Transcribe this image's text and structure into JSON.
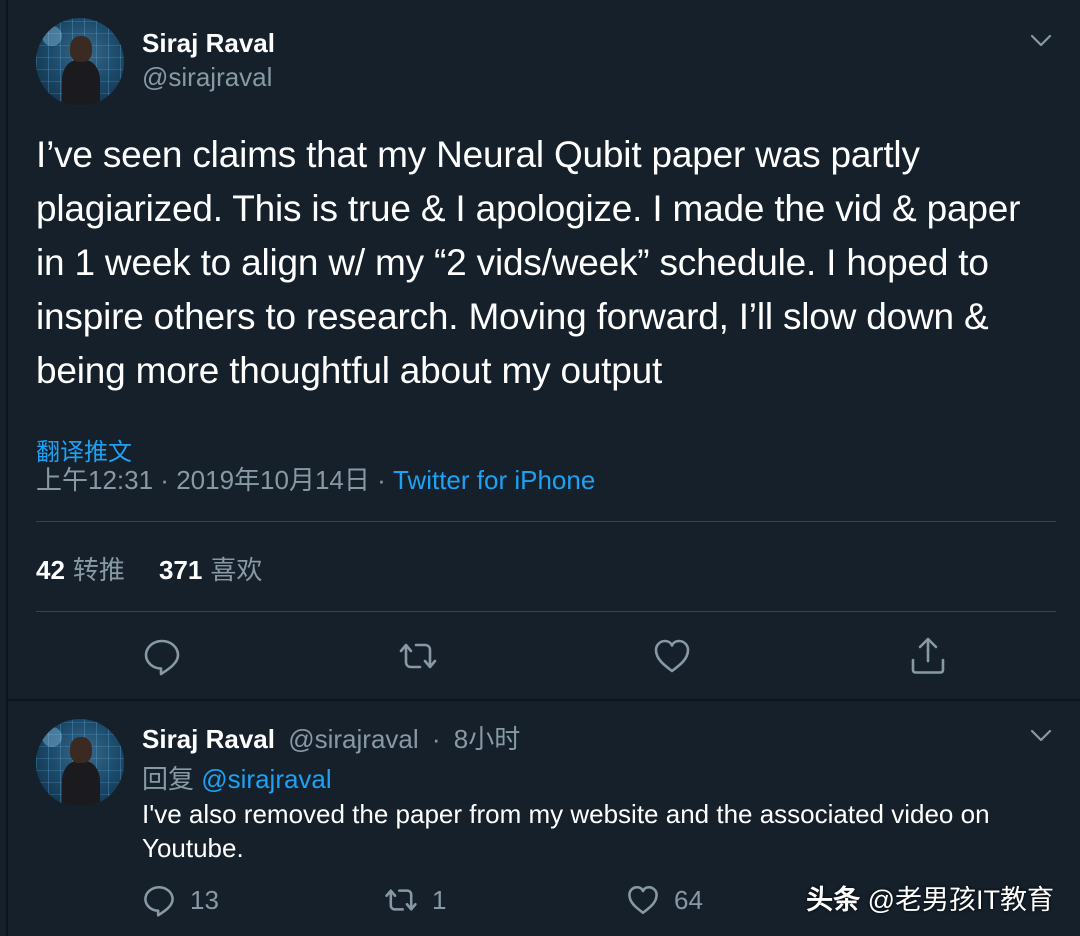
{
  "main_tweet": {
    "display_name": "Siraj Raval",
    "handle": "@sirajraval",
    "text": "I’ve seen claims that my Neural Qubit paper was partly plagiarized. This is true & I apologize. I made the vid & paper in 1 week to align w/ my “2 vids/week” schedule. I hoped to inspire others to research. Moving forward, I’ll slow down & being more thoughtful about my output",
    "translate_label": "翻译推文",
    "time": "上午12:31",
    "date": "2019年10月14日",
    "separator": " · ",
    "source": "Twitter for iPhone",
    "retweets_count": "42",
    "retweets_label": "转推",
    "likes_count": "371",
    "likes_label": "喜欢",
    "actions": [
      "reply-icon",
      "retweet-icon",
      "like-icon",
      "share-icon"
    ]
  },
  "reply_tweet": {
    "display_name": "Siraj Raval",
    "handle": "@sirajraval",
    "time_separator": "·",
    "time_ago": "8小时",
    "replying_prefix": "回复",
    "replying_to": "@sirajraval",
    "text": "I've also removed the paper from my website and the associated video on Youtube.",
    "reply_count": "13",
    "retweet_count": "1",
    "like_count": "64"
  },
  "watermark": {
    "brand": "头条",
    "account": "@老男孩IT教育"
  },
  "colors": {
    "background": "#15202b",
    "accent": "#1da1f2",
    "secondary_text": "#8899a6",
    "divider": "#38444d"
  }
}
